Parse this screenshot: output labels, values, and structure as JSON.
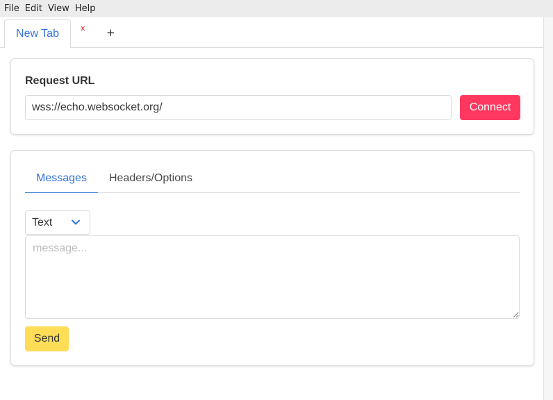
{
  "menu": [
    "File",
    "Edit",
    "View",
    "Help"
  ],
  "tabbar": {
    "tab_label": "New Tab",
    "close_label": "x",
    "add_label": "+"
  },
  "request": {
    "label": "Request URL",
    "url_value": "wss://echo.websocket.org/",
    "connect_label": "Connect"
  },
  "messages": {
    "tabs": [
      "Messages",
      "Headers/Options"
    ],
    "format_selected": "Text",
    "message_placeholder": "message...",
    "send_label": "Send"
  },
  "colors": {
    "accent": "#3273dc",
    "connect": "#ff3860",
    "send": "#ffdd57",
    "close": "#e02a2a"
  },
  "icons": {
    "format_toggle": "chevron-down-icon"
  }
}
